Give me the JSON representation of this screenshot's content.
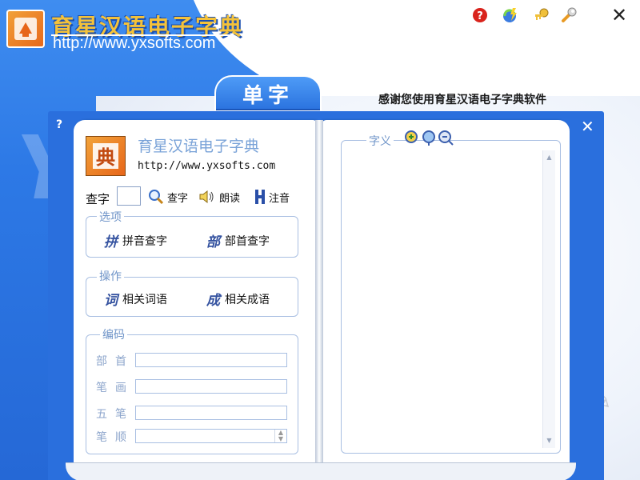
{
  "header": {
    "app_title": "育星汉语电子字典",
    "url": "http://www.yxsofts.com"
  },
  "toolbar": {
    "help_icon": "help-icon",
    "update_icon": "update-icon",
    "register_icon": "key-icon",
    "settings_icon": "wrench-icon",
    "close_label": "✕"
  },
  "tab": {
    "label": "单字"
  },
  "slogan": "感谢您使用育星汉语电子字典软件",
  "book": {
    "help_label": "?",
    "close_label": "✕",
    "title": "育星汉语电子字典",
    "url": "http://www.yxsofts.com",
    "search": {
      "label": "查字",
      "value": "",
      "query_label": "查字",
      "read_label": "朗读",
      "phonetic_label": "注音"
    },
    "options": {
      "title": "选项",
      "pinyin_glyph": "拼",
      "pinyin_label": "拼音查字",
      "radical_glyph": "部",
      "radical_label": "部首查字"
    },
    "operations": {
      "title": "操作",
      "words_glyph": "词",
      "words_label": "相关词语",
      "idioms_glyph": "成",
      "idioms_label": "相关成语"
    },
    "encoding": {
      "title": "编码",
      "radical_label": "部首",
      "strokes_label": "笔画",
      "wubi_label": "五笔",
      "order_label": "笔顺",
      "radical_value": "",
      "strokes_value": "",
      "wubi_value": "",
      "order_value": ""
    },
    "definition": {
      "title": "字义",
      "text": ""
    }
  },
  "colors": {
    "accent_blue": "#2a6fdd",
    "group_border": "#a9bfe2",
    "group_title": "#6f94c8",
    "title_gold": "#f4c23a"
  }
}
